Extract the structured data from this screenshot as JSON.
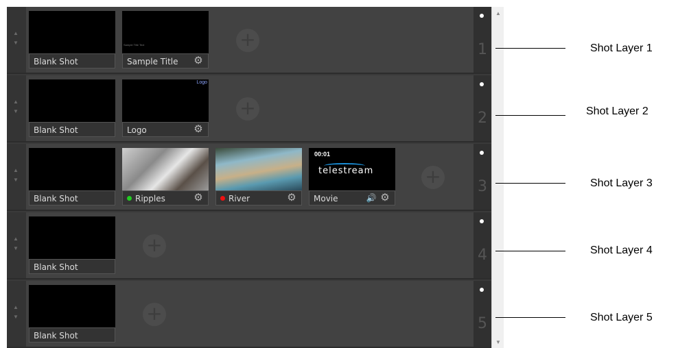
{
  "panel": {
    "layers": [
      {
        "number": "1",
        "shots": [
          {
            "label": "Blank Shot"
          },
          {
            "label": "Sample Title",
            "gear": "⚙",
            "mini_text": "Sample Title Text"
          }
        ]
      },
      {
        "number": "2",
        "shots": [
          {
            "label": "Blank Shot"
          },
          {
            "label": "Logo",
            "gear": "⚙",
            "thumb_text": "Logo"
          }
        ]
      },
      {
        "number": "3",
        "shots": [
          {
            "label": "Blank Shot"
          },
          {
            "label": "Ripples",
            "gear": "⚙",
            "status_color": "#22cc22"
          },
          {
            "label": "River",
            "gear": "⚙",
            "status_color": "#ee1111"
          },
          {
            "label": "Movie",
            "gear": "⚙",
            "volume": "🔊",
            "time": "00:01",
            "brand": "telestream"
          }
        ]
      },
      {
        "number": "4",
        "shots": [
          {
            "label": "Blank Shot"
          }
        ]
      },
      {
        "number": "5",
        "shots": [
          {
            "label": "Blank Shot"
          }
        ]
      }
    ],
    "add_glyph": "+",
    "up_arrow": "▲",
    "down_arrow": "▼"
  },
  "scrollbar": {
    "up": "▲",
    "down": "▼"
  },
  "callouts": [
    "Shot Layer 1",
    "Shot Layer 2",
    "Shot Layer 3",
    "Shot Layer 4",
    "Shot Layer 5"
  ],
  "icons": {
    "gear": "gear-icon",
    "volume": "volume-icon",
    "add": "add-shot-icon",
    "on_air": "on-air-indicator"
  },
  "colors": {
    "panel_bg": "#424242",
    "label_text": "#dcdcdc",
    "status_green": "#22cc22",
    "status_red": "#ee1111"
  }
}
